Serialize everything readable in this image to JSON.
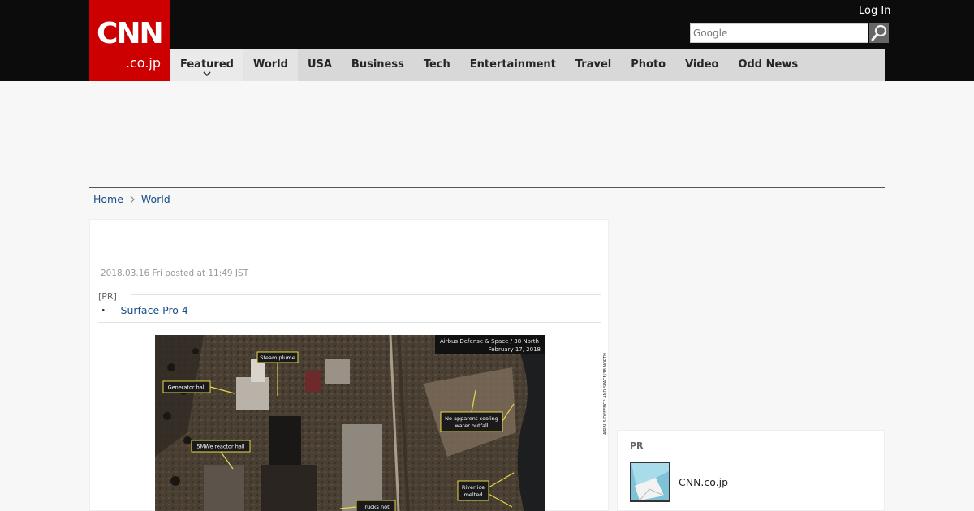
{
  "header": {
    "logo_main": "CNN",
    "logo_sub": ".co.jp",
    "login_label": "Log In",
    "search_placeholder": "Google"
  },
  "nav": {
    "items": [
      {
        "label": "Featured"
      },
      {
        "label": "World"
      },
      {
        "label": "USA"
      },
      {
        "label": "Business"
      },
      {
        "label": "Tech"
      },
      {
        "label": "Entertainment"
      },
      {
        "label": "Travel"
      },
      {
        "label": "Photo"
      },
      {
        "label": "Video"
      },
      {
        "label": "Odd News"
      }
    ]
  },
  "breadcrumb": {
    "home": "Home",
    "current": "World"
  },
  "article": {
    "dateline": "2018.03.16 Fri posted at 11:49 JST",
    "pr_label": "[PR]",
    "pr_link": "--Surface Pro 4",
    "image": {
      "credit_box_line1": "Airbus Defense & Space / 38 North",
      "credit_box_line2": "February 17, 2018",
      "side_credit": "AIRBUS DEFENCE AND SPACE/38 NORTH",
      "callouts": {
        "steam_plume": "Steam plume",
        "generator_hall": "Generator hall",
        "no_cooling_line1": "No apparent cooling",
        "no_cooling_line2": "water outfall",
        "reactor_hall": "5MWe reactor hall",
        "river_ice_line1": "River ice",
        "river_ice_line2": "melted",
        "trucks_not": "Trucks not"
      }
    }
  },
  "sidebar": {
    "pr_label": "PR",
    "item_label": "CNN.co.jp"
  },
  "colors": {
    "brand_red": "#cc0000",
    "topbar": "#0c0c0c",
    "nav_bg": "#d8d8d8",
    "link": "#1a4f8a"
  }
}
